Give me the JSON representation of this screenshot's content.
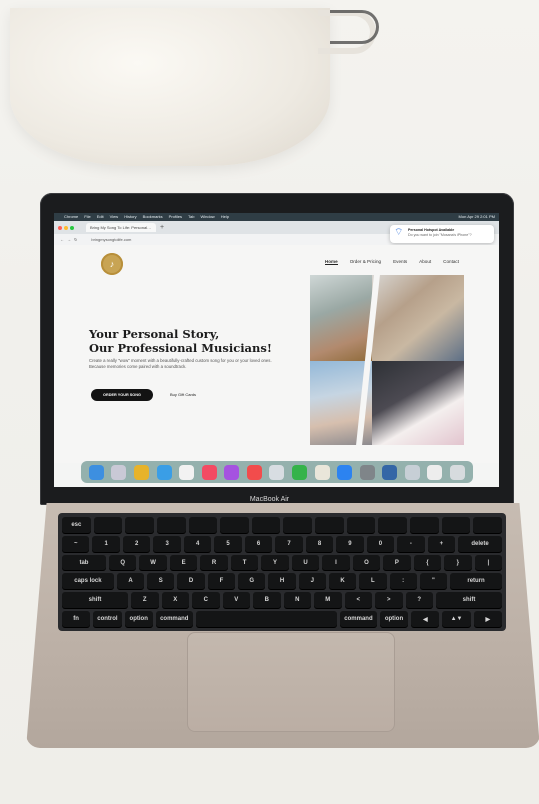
{
  "menubar": {
    "items": [
      "Chrome",
      "File",
      "Edit",
      "View",
      "History",
      "Bookmarks",
      "Profiles",
      "Tab",
      "Window",
      "Help"
    ],
    "clock": "Mon Apr 29  2:01 PM"
  },
  "browser": {
    "tab_title": "Bring My Song To Life: Personal…",
    "url": "bringmysongtolife.com"
  },
  "notification": {
    "title": "Personal Hotspot Available",
    "subtitle": "Do you want to join \"Mosana's iPhone\"?"
  },
  "site": {
    "nav": [
      "Home",
      "Order & Pricing",
      "Events",
      "About",
      "Contact"
    ],
    "headline_1": "Your Personal Story,",
    "headline_2": "Our Professional Musicians!",
    "subtext": "Create a really \"wow\" moment with a beautifully-crafted custom song for you or your loved ones. Because memories come paired with a soundtrack.",
    "cta": "ORDER YOUR SONG",
    "gift": "Buy Gift Cards"
  },
  "laptop": {
    "brand": "MacBook Air"
  },
  "keys": [
    [
      "esc",
      "",
      "",
      "",
      "",
      "",
      "",
      "",
      "",
      "",
      "",
      "",
      "",
      ""
    ],
    [
      "~",
      "1",
      "2",
      "3",
      "4",
      "5",
      "6",
      "7",
      "8",
      "9",
      "0",
      "-",
      "+",
      "delete"
    ],
    [
      "tab",
      "Q",
      "W",
      "E",
      "R",
      "T",
      "Y",
      "U",
      "I",
      "O",
      "P",
      "{",
      "}",
      "|"
    ],
    [
      "caps lock",
      "A",
      "S",
      "D",
      "F",
      "G",
      "H",
      "J",
      "K",
      "L",
      ":",
      "\"",
      "return"
    ],
    [
      "shift",
      "Z",
      "X",
      "C",
      "V",
      "B",
      "N",
      "M",
      "<",
      ">",
      "?",
      "shift"
    ],
    [
      "fn",
      "control",
      "option",
      "command",
      "",
      "command",
      "option",
      "◀",
      "▲▼",
      "▶"
    ]
  ]
}
